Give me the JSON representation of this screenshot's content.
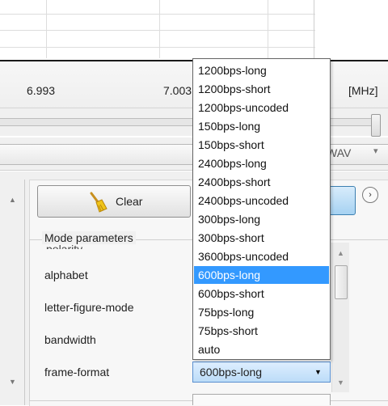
{
  "axis": {
    "labels": [
      "6.993",
      "7.003",
      "[MHz]"
    ]
  },
  "wav_combo": {
    "value": "WAV",
    "arrow": "▾"
  },
  "clear_button": {
    "label": "Clear"
  },
  "circle_button": {
    "glyph": "›"
  },
  "mode_parameters": {
    "title": "Mode parameters",
    "ghost_label": "polarity",
    "labels": {
      "alphabet": "alphabet",
      "letter_figure_mode": "letter-figure-mode",
      "bandwidth": "bandwidth",
      "frame_format": "frame-format"
    }
  },
  "frame_format_combo": {
    "value": "600bps-long",
    "arrow": "▼"
  },
  "dropdown": {
    "options": [
      "1200bps-long",
      "1200bps-short",
      "1200bps-uncoded",
      "150bps-long",
      "150bps-short",
      "2400bps-long",
      "2400bps-short",
      "2400bps-uncoded",
      "300bps-long",
      "300bps-short",
      "3600bps-uncoded",
      "600bps-long",
      "600bps-short",
      "75bps-long",
      "75bps-short",
      "auto"
    ],
    "selected_index": 11
  },
  "scroll_glyphs": {
    "up": "▲",
    "down": "▼"
  },
  "colors": {
    "selection": "#3399ff",
    "accent_button": "#a6d2f2",
    "broom_handle": "#c8901e",
    "broom_bristles": "#f0c419"
  }
}
